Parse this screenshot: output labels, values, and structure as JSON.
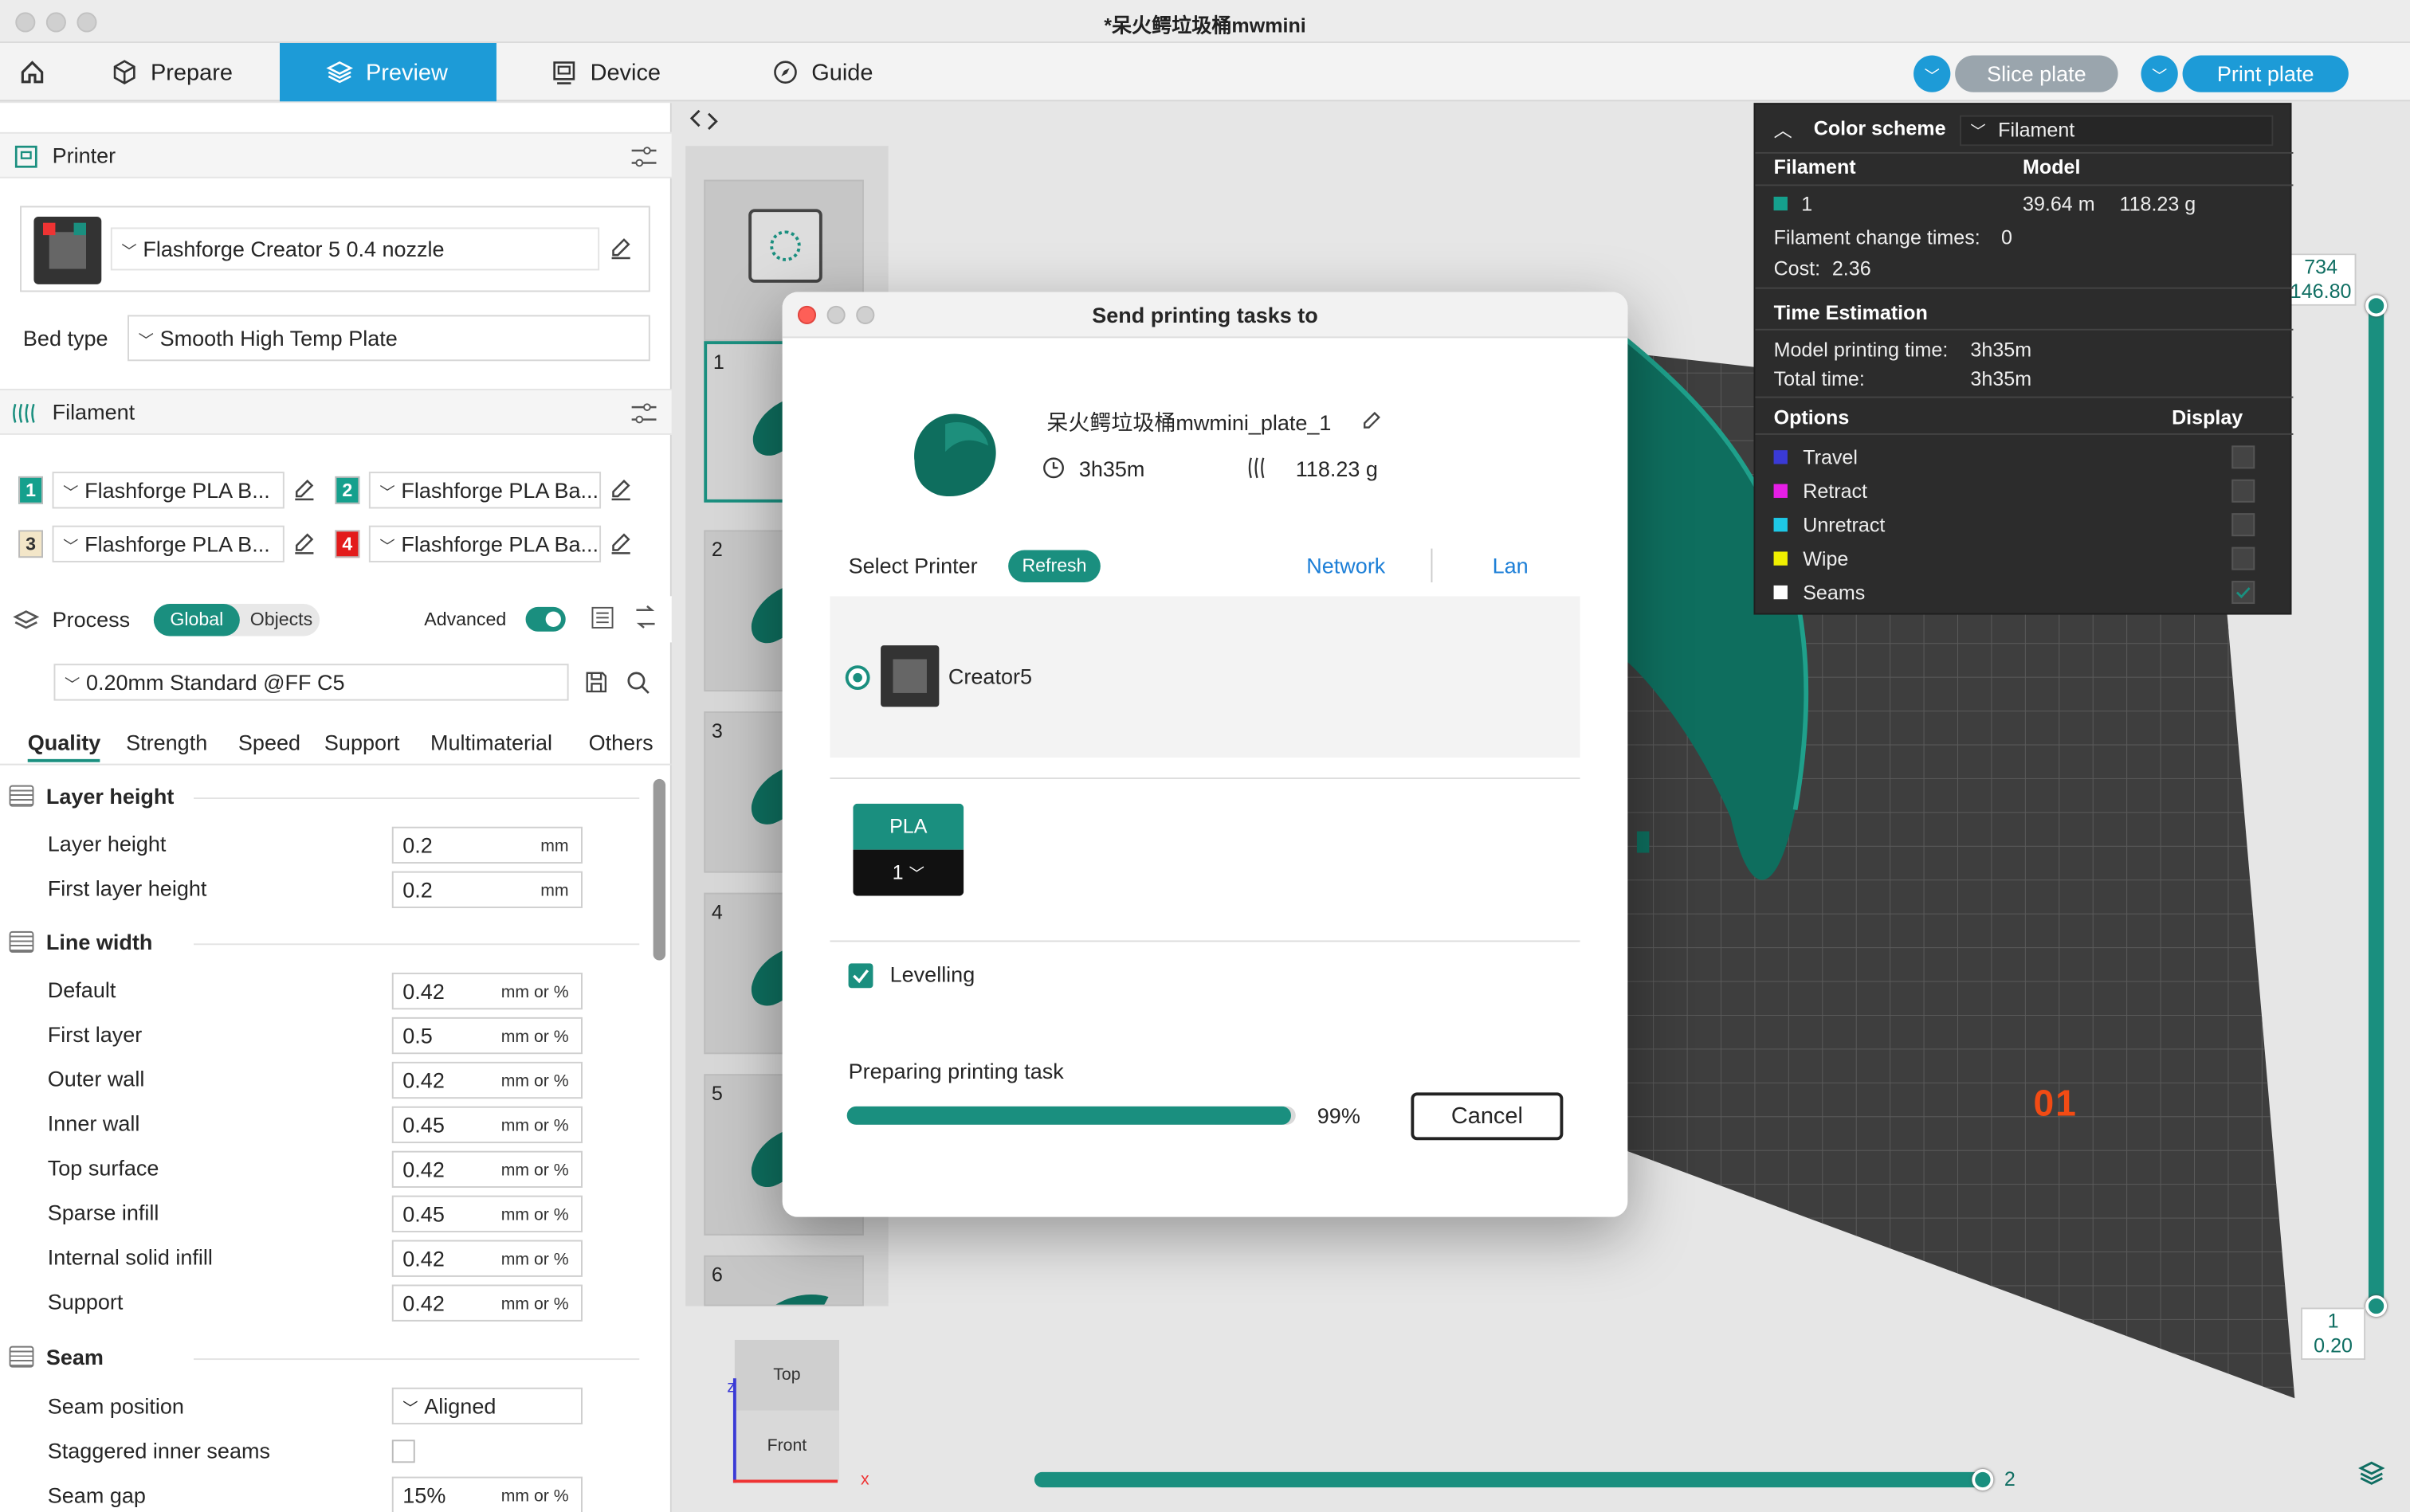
{
  "window": {
    "title": "*呆火鳄垃圾桶mwmini"
  },
  "menu": {
    "home": "home",
    "prepare": "Prepare",
    "preview": "Preview",
    "device": "Device",
    "guide": "Guide",
    "slice": "Slice plate",
    "print": "Print plate"
  },
  "printer": {
    "section": "Printer",
    "preset": "Flashforge Creator 5 0.4 nozzle",
    "bed_label": "Bed type",
    "bed_value": "Smooth High Temp Plate"
  },
  "filament": {
    "section": "Filament",
    "slots": [
      {
        "num": "1",
        "name": "Flashforge PLA B...",
        "color": "#15a08d"
      },
      {
        "num": "2",
        "name": "Flashforge PLA Ba...",
        "color": "#15a08d"
      },
      {
        "num": "3",
        "name": "Flashforge PLA B...",
        "color": "#f3e6c8"
      },
      {
        "num": "4",
        "name": "Flashforge PLA Ba...",
        "color": "#e31b1b"
      }
    ]
  },
  "process": {
    "section": "Process",
    "global": "Global",
    "objects": "Objects",
    "advanced": "Advanced",
    "preset": "0.20mm Standard @FF C5",
    "tabs": [
      "Quality",
      "Strength",
      "Speed",
      "Support",
      "Multimaterial",
      "Others"
    ]
  },
  "quality": {
    "layer_group": "Layer height",
    "layer_rows": [
      {
        "label": "Layer height",
        "value": "0.2",
        "unit": "mm"
      },
      {
        "label": "First layer height",
        "value": "0.2",
        "unit": "mm"
      }
    ],
    "line_group": "Line width",
    "line_rows": [
      {
        "label": "Default",
        "value": "0.42",
        "unit": "mm or %"
      },
      {
        "label": "First layer",
        "value": "0.5",
        "unit": "mm or %"
      },
      {
        "label": "Outer wall",
        "value": "0.42",
        "unit": "mm or %"
      },
      {
        "label": "Inner wall",
        "value": "0.45",
        "unit": "mm or %"
      },
      {
        "label": "Top surface",
        "value": "0.42",
        "unit": "mm or %"
      },
      {
        "label": "Sparse infill",
        "value": "0.45",
        "unit": "mm or %"
      },
      {
        "label": "Internal solid infill",
        "value": "0.42",
        "unit": "mm or %"
      },
      {
        "label": "Support",
        "value": "0.42",
        "unit": "mm or %"
      }
    ],
    "seam_group": "Seam",
    "seam_position_label": "Seam position",
    "seam_position_value": "Aligned",
    "staggered_label": "Staggered inner seams",
    "seam_gap_label": "Seam gap",
    "seam_gap_value": "15%",
    "seam_gap_unit": "mm or %"
  },
  "plates": [
    {
      "num": ""
    },
    {
      "num": "1"
    },
    {
      "num": "2"
    },
    {
      "num": "3"
    },
    {
      "num": "4"
    },
    {
      "num": "5"
    },
    {
      "num": "6"
    }
  ],
  "color_scheme": {
    "title": "Color scheme",
    "value": "Filament",
    "col_filament": "Filament",
    "col_model": "Model",
    "row_num": "1",
    "row_length": "39.64 m",
    "row_weight": "118.23 g",
    "change_times_label": "Filament change times:",
    "change_times_value": "0",
    "cost_label": "Cost:",
    "cost_value": "2.36",
    "time_title": "Time Estimation",
    "model_time_label": "Model printing time:",
    "model_time_value": "3h35m",
    "total_time_label": "Total time:",
    "total_time_value": "3h35m",
    "options_label": "Options",
    "display_label": "Display",
    "options": [
      {
        "name": "Travel",
        "color": "#3a3ad6",
        "checked": false
      },
      {
        "name": "Retract",
        "color": "#e61ee6",
        "checked": false
      },
      {
        "name": "Unretract",
        "color": "#1ec8e6",
        "checked": false
      },
      {
        "name": "Wipe",
        "color": "#f0f000",
        "checked": false
      },
      {
        "name": "Seams",
        "color": "#ffffff",
        "checked": true
      }
    ]
  },
  "layer_slider": {
    "top_a": "734",
    "top_b": "146.80",
    "bottom_a": "1",
    "bottom_b": "0.20",
    "h_value": "2",
    "progress_top": 1.0,
    "progress_bottom": 0.0
  },
  "viewport": {
    "plate_label": "01",
    "cube_top": "Top",
    "cube_front": "Front",
    "axis_z": "z",
    "axis_x": "x"
  },
  "dialog": {
    "title": "Send printing tasks to",
    "plate_name": "呆火鳄垃圾桶mwmini_plate_1",
    "time": "3h35m",
    "weight": "118.23 g",
    "select_printer": "Select Printer",
    "refresh": "Refresh",
    "network": "Network",
    "lan": "Lan",
    "printer_name": "Creator5",
    "material": "PLA",
    "material_slot": "1",
    "levelling": "Levelling",
    "preparing": "Preparing printing task",
    "progress": 0.99,
    "progress_text": "99%",
    "cancel": "Cancel"
  },
  "colors": {
    "accent": "#1a8f7f",
    "tab_active": "#1d9bd7",
    "pill_disabled": "#9aa5ad"
  }
}
